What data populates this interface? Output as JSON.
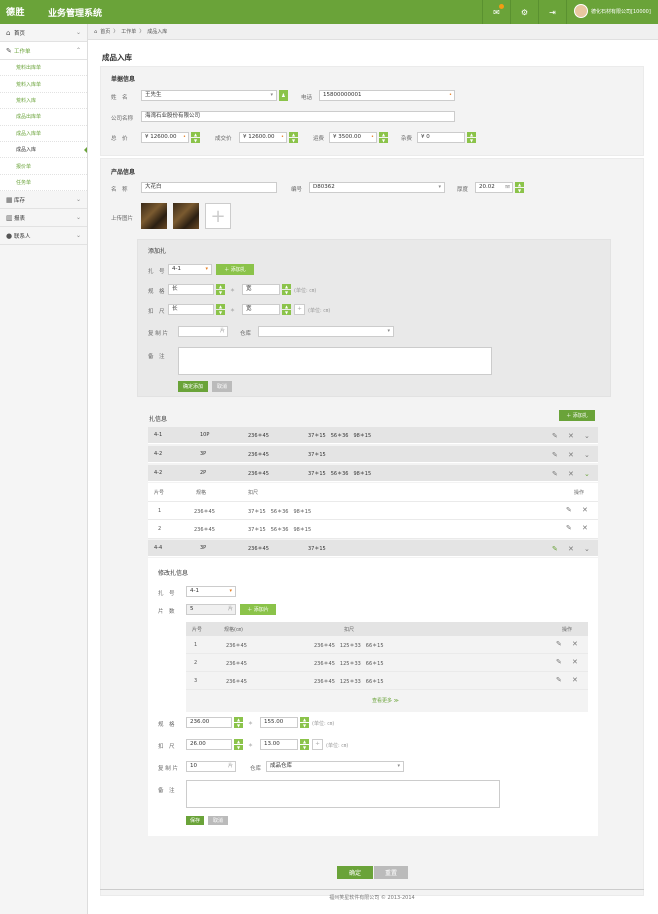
{
  "app": {
    "logo": "德胜",
    "title": "业务管理系统",
    "user": "德化石材有限公司[10000]"
  },
  "topbar": {
    "icons": [
      "mail-icon",
      "gear-icon",
      "logout-icon"
    ]
  },
  "sidebar": {
    "items": [
      {
        "label": "首页"
      },
      {
        "label": "工作单"
      },
      {
        "label": "库存"
      },
      {
        "label": "报表"
      },
      {
        "label": "联系人"
      }
    ],
    "sub_items": [
      "荒料出库单",
      "荒料入库单",
      "荒料入库",
      "成品出库单",
      "成品入库单",
      "成品入库",
      "报价单",
      "任务单"
    ]
  },
  "breadcrumb": {
    "home": "首页",
    "sep": "〉",
    "level1": "工作单",
    "level2": "成品入库"
  },
  "page": {
    "title": "成品入库"
  },
  "order": {
    "section_title": "单据信息",
    "name_label": "姓　名",
    "name_value": "王先生",
    "phone_label": "电话",
    "phone_value": "15800000001",
    "company_label": "公司名称",
    "company_value": "海湾石业股份有限公司",
    "total_label": "总　价",
    "total_value": "¥ 12600.00",
    "deal_label": "成交价",
    "deal_value": "¥ 12600.00",
    "freight_label": "运费",
    "freight_value": "¥ 3500.00",
    "misc_label": "杂费",
    "misc_value": "¥ 0"
  },
  "product": {
    "section_title": "产品信息",
    "name_label": "名　称",
    "name_value": "大花白",
    "code_label": "编号",
    "code_value": "D80362",
    "thick_label": "厚度",
    "thick_value": "20.02",
    "thick_unit": "㎜",
    "upload_label": "上传图片"
  },
  "add_zha": {
    "title": "添加扎",
    "no_label": "扎　号",
    "no_value": "4-1",
    "add_btn": "添加扎",
    "spec_label": "规　格",
    "spec_long": "长",
    "spec_wide": "宽",
    "spec_unit": "(单位: ㎝)",
    "cut_label": "扣　尺",
    "cut_long": "长",
    "cut_wide": "宽",
    "cut_unit": "(单位: ㎝)",
    "count_label": "复 制 片",
    "count_unit": "片",
    "wh_label": "仓库",
    "note_label": "备　注",
    "confirm_btn": "确定添加",
    "cancel_btn": "取消"
  },
  "zha_info": {
    "title": "扎信息",
    "add_btn": "添加扎",
    "rows": [
      {
        "id": "4-1",
        "count": "10P",
        "spec": "236＊45",
        "cut": "37＊15　56＊36　98＊15"
      },
      {
        "id": "4-2",
        "count": "3P",
        "spec": "236＊45",
        "cut": "37＊15"
      },
      {
        "id": "4-2",
        "count": "2P",
        "spec": "236＊45",
        "cut": "37＊15　56＊36　98＊15"
      }
    ],
    "piece_headers": [
      "片号",
      "规格",
      "扣尺",
      "操作"
    ],
    "pieces": [
      {
        "no": "1",
        "spec": "236＊45",
        "cut": "37＊15　56＊36　98＊15"
      },
      {
        "no": "2",
        "spec": "236＊45",
        "cut": "37＊15　56＊36　98＊15"
      }
    ],
    "row4": {
      "id": "4-4",
      "count": "3P",
      "spec": "236＊45",
      "cut": "37＊15"
    }
  },
  "edit_zha": {
    "title": "修改扎信息",
    "no_label": "扎　号",
    "no_value": "4-1",
    "pcs_label": "片　数",
    "pcs_value": "5",
    "pcs_unit": "片",
    "add_btn": "添加片",
    "headers": [
      "片号",
      "规格(㎝)",
      "扣尺",
      "操作"
    ],
    "pieces": [
      {
        "no": "1",
        "spec": "236＊45",
        "cut": "236＊45　125＊33　66＊15"
      },
      {
        "no": "2",
        "spec": "236＊45",
        "cut": "236＊45　125＊33　66＊15"
      },
      {
        "no": "3",
        "spec": "236＊45",
        "cut": "236＊45　125＊33　66＊15"
      }
    ],
    "more": "查看更多 ≫",
    "spec_label": "规　格",
    "spec_long": "236.00",
    "spec_wide": "155.00",
    "spec_unit": "(单位: ㎝)",
    "cut_label": "扣　尺",
    "cut_long": "26.00",
    "cut_wide": "13.00",
    "cut_unit": "(单位: ㎝)",
    "count_label": "复 制 片",
    "count_value": "10",
    "count_unit": "片",
    "wh_label": "仓库",
    "wh_value": "成品仓库",
    "note_label": "备　注",
    "save_btn": "保存",
    "cancel_btn": "取消"
  },
  "actions": {
    "confirm": "确定",
    "reset": "重置"
  },
  "footer": {
    "text": "福州笑星软件有限公司 © 2013-2014"
  },
  "colors": {
    "brand": "#6aa339",
    "accent": "#8bc34a"
  }
}
